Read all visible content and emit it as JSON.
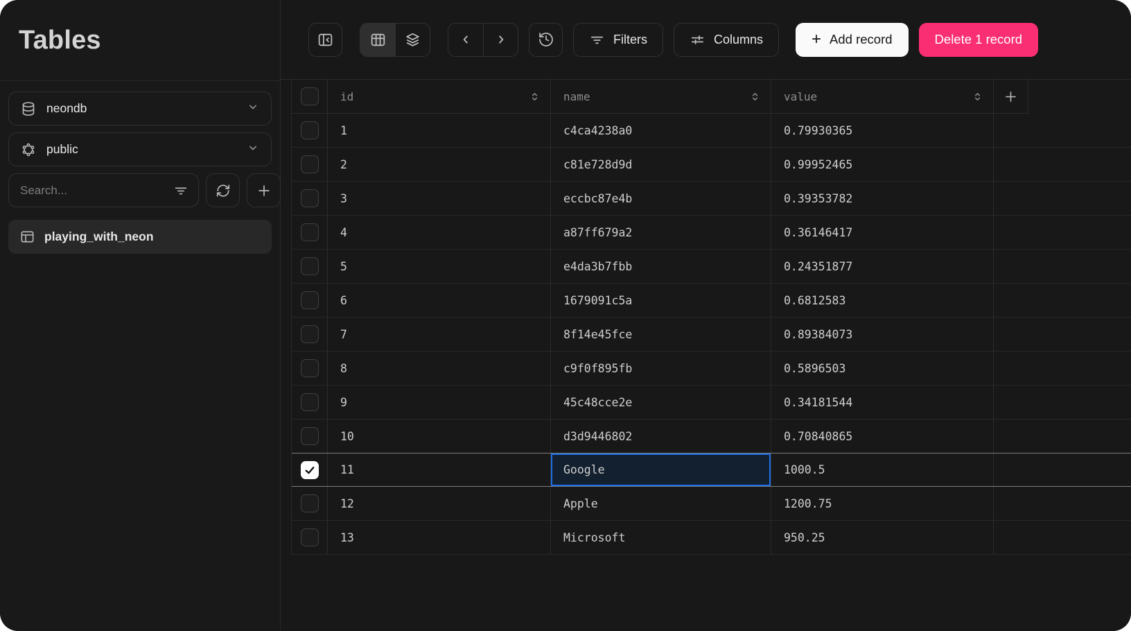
{
  "sidebar": {
    "title": "Tables",
    "database": {
      "label": "neondb",
      "icon": "database-icon"
    },
    "schema": {
      "label": "public",
      "icon": "schema-icon"
    },
    "search": {
      "placeholder": "Search..."
    },
    "table_list": [
      {
        "label": "playing_with_neon",
        "selected": true
      }
    ]
  },
  "toolbar": {
    "filters": {
      "label": "Filters"
    },
    "columns": {
      "label": "Columns"
    },
    "add_record": {
      "plus_glyph": "+",
      "label": "Add record"
    },
    "delete_record": {
      "label": "Delete 1 record"
    },
    "view_mode": "table"
  },
  "grid": {
    "columns": [
      {
        "label": "id"
      },
      {
        "label": "name"
      },
      {
        "label": "value"
      }
    ],
    "rows": [
      {
        "id": "1",
        "name": "c4ca4238a0",
        "value": "0.79930365",
        "checked": false
      },
      {
        "id": "2",
        "name": "c81e728d9d",
        "value": "0.99952465",
        "checked": false
      },
      {
        "id": "3",
        "name": "eccbc87e4b",
        "value": "0.39353782",
        "checked": false
      },
      {
        "id": "4",
        "name": "a87ff679a2",
        "value": "0.36146417",
        "checked": false
      },
      {
        "id": "5",
        "name": "e4da3b7fbb",
        "value": "0.24351877",
        "checked": false
      },
      {
        "id": "6",
        "name": "1679091c5a",
        "value": "0.6812583",
        "checked": false
      },
      {
        "id": "7",
        "name": "8f14e45fce",
        "value": "0.89384073",
        "checked": false
      },
      {
        "id": "8",
        "name": "c9f0f895fb",
        "value": "0.5896503",
        "checked": false
      },
      {
        "id": "9",
        "name": "45c48cce2e",
        "value": "0.34181544",
        "checked": false
      },
      {
        "id": "10",
        "name": "d3d9446802",
        "value": "0.70840865",
        "checked": false
      },
      {
        "id": "11",
        "name": "Google",
        "value": "1000.5",
        "checked": true,
        "selected_cell": "name"
      },
      {
        "id": "12",
        "name": "Apple",
        "value": "1200.75",
        "checked": false
      },
      {
        "id": "13",
        "name": "Microsoft",
        "value": "950.25",
        "checked": false
      }
    ],
    "selection": {
      "checked_row_id": "11",
      "selected_cell_column": "name",
      "checked_count": 1
    }
  },
  "colors": {
    "accent_blue": "#1e6fe8",
    "danger_pink": "#fa2e73",
    "selected_cell_bg": "#13202f",
    "app_bg": "#181818"
  }
}
